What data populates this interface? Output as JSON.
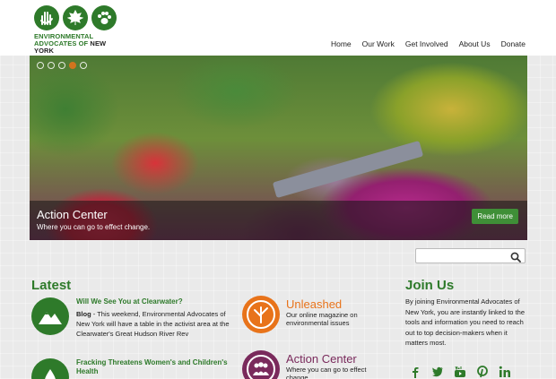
{
  "logo": {
    "line1": "ENVIRONMENTAL",
    "line2_green": "ADVOCATES OF ",
    "line2_dark": "NEW YORK",
    "icons": [
      "hand-icon",
      "maple-leaf-icon",
      "paw-icon"
    ]
  },
  "nav": {
    "items": [
      "Home",
      "Our Work",
      "Get Involved",
      "About Us",
      "Donate"
    ]
  },
  "hero": {
    "title": "Action Center",
    "subtitle": "Where you can go to effect change.",
    "button": "Read more",
    "slide_count": 5,
    "active_slide": 3,
    "accent": "#e8731a"
  },
  "search": {
    "placeholder": ""
  },
  "latest": {
    "title": "Latest",
    "posts": [
      {
        "title": "Will We See You at Clearwater?",
        "category": "Blog",
        "body": " - This weekend, Environmental Advocates of New York will have a table in the activist area at the Clearwater's Great Hudson River Rev",
        "icon": "mountain-icon"
      },
      {
        "title": "Fracking Threatens Women's and Children's Health",
        "icon": "water-drop-icon"
      }
    ]
  },
  "features": [
    {
      "title": "Unleashed",
      "subtitle": "Our online magazine on environmental issues",
      "color": "#e8731a",
      "icon": "tree-icon"
    },
    {
      "title": "Action Center",
      "subtitle": "Where you can go to effect change",
      "color": "#7a2a5c",
      "icon": "people-icon"
    }
  ],
  "join": {
    "title": "Join Us",
    "body": "By joining Environmental Advocates of New York, you are instantly linked to the tools and information you need to reach out to top decision-makers when it matters most."
  },
  "social": [
    "facebook-icon",
    "twitter-icon",
    "youtube-icon",
    "pinterest-icon",
    "linkedin-icon"
  ],
  "colors": {
    "brand_green": "#2e7a2a",
    "orange": "#e8731a",
    "purple": "#7a2a5c"
  }
}
